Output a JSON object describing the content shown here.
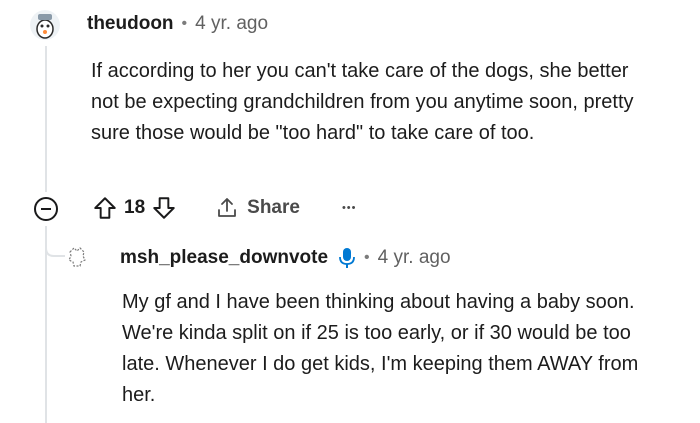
{
  "comment": {
    "username": "theudoon",
    "time": "4 yr. ago",
    "body": "If according to her you can't take care of the dogs, she better not be expecting grandchildren from you anytime soon, pretty sure those would be \"too hard\" to take care of too.",
    "votes": "18",
    "share_label": "Share",
    "more_label": "•••"
  },
  "reply": {
    "username": "msh_please_downvote",
    "time": "4 yr. ago",
    "body": "My gf and I have been thinking about having a baby soon. We're kinda split on if 25 is too early, or if 30 would be too late. Whenever I do get kids, I'm keeping them AWAY from her."
  },
  "colors": {
    "accent_blue": "#0079d3",
    "text": "#1c1c1c",
    "muted": "#616161",
    "thread": "#e0e3e6"
  },
  "icons": [
    "avatar-theudoon",
    "collapse-icon",
    "upvote-icon",
    "downvote-icon",
    "share-icon",
    "more-icon",
    "avatar-msh",
    "microphone-icon"
  ]
}
